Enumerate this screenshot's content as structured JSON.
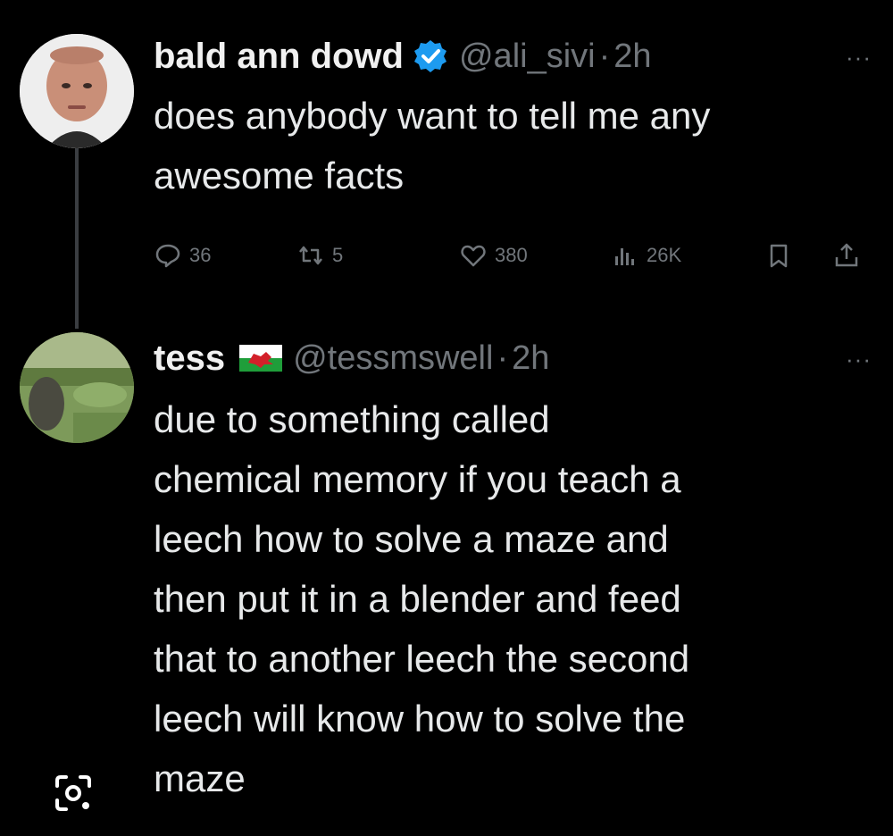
{
  "tweet1": {
    "name": "bald ann dowd",
    "handle": "@ali_sivi",
    "time": "2h",
    "separator": "·",
    "text_lines": [
      "does anybody want to tell me any",
      "awesome facts"
    ],
    "stats": {
      "replies": "36",
      "reposts": "5",
      "likes": "380",
      "views": "26K"
    }
  },
  "tweet2": {
    "name": "tess",
    "handle": "@tessmswell",
    "time": "2h",
    "separator": "·",
    "text_lines": [
      "due to something called",
      "chemical memory if you teach a",
      "leech how to solve a maze and",
      "then put it in a blender and feed",
      "that to another leech the second",
      "leech will know how to solve the",
      "maze"
    ]
  },
  "more_label": "···",
  "colors": {
    "background": "#000000",
    "text": "#e7e9ea",
    "muted": "#71767b",
    "verified": "#1d9bf0"
  },
  "icons": [
    "verified-badge-icon",
    "wales-flag-icon",
    "reply-icon",
    "repost-icon",
    "like-icon",
    "views-icon",
    "bookmark-icon",
    "share-icon",
    "lens-icon"
  ]
}
